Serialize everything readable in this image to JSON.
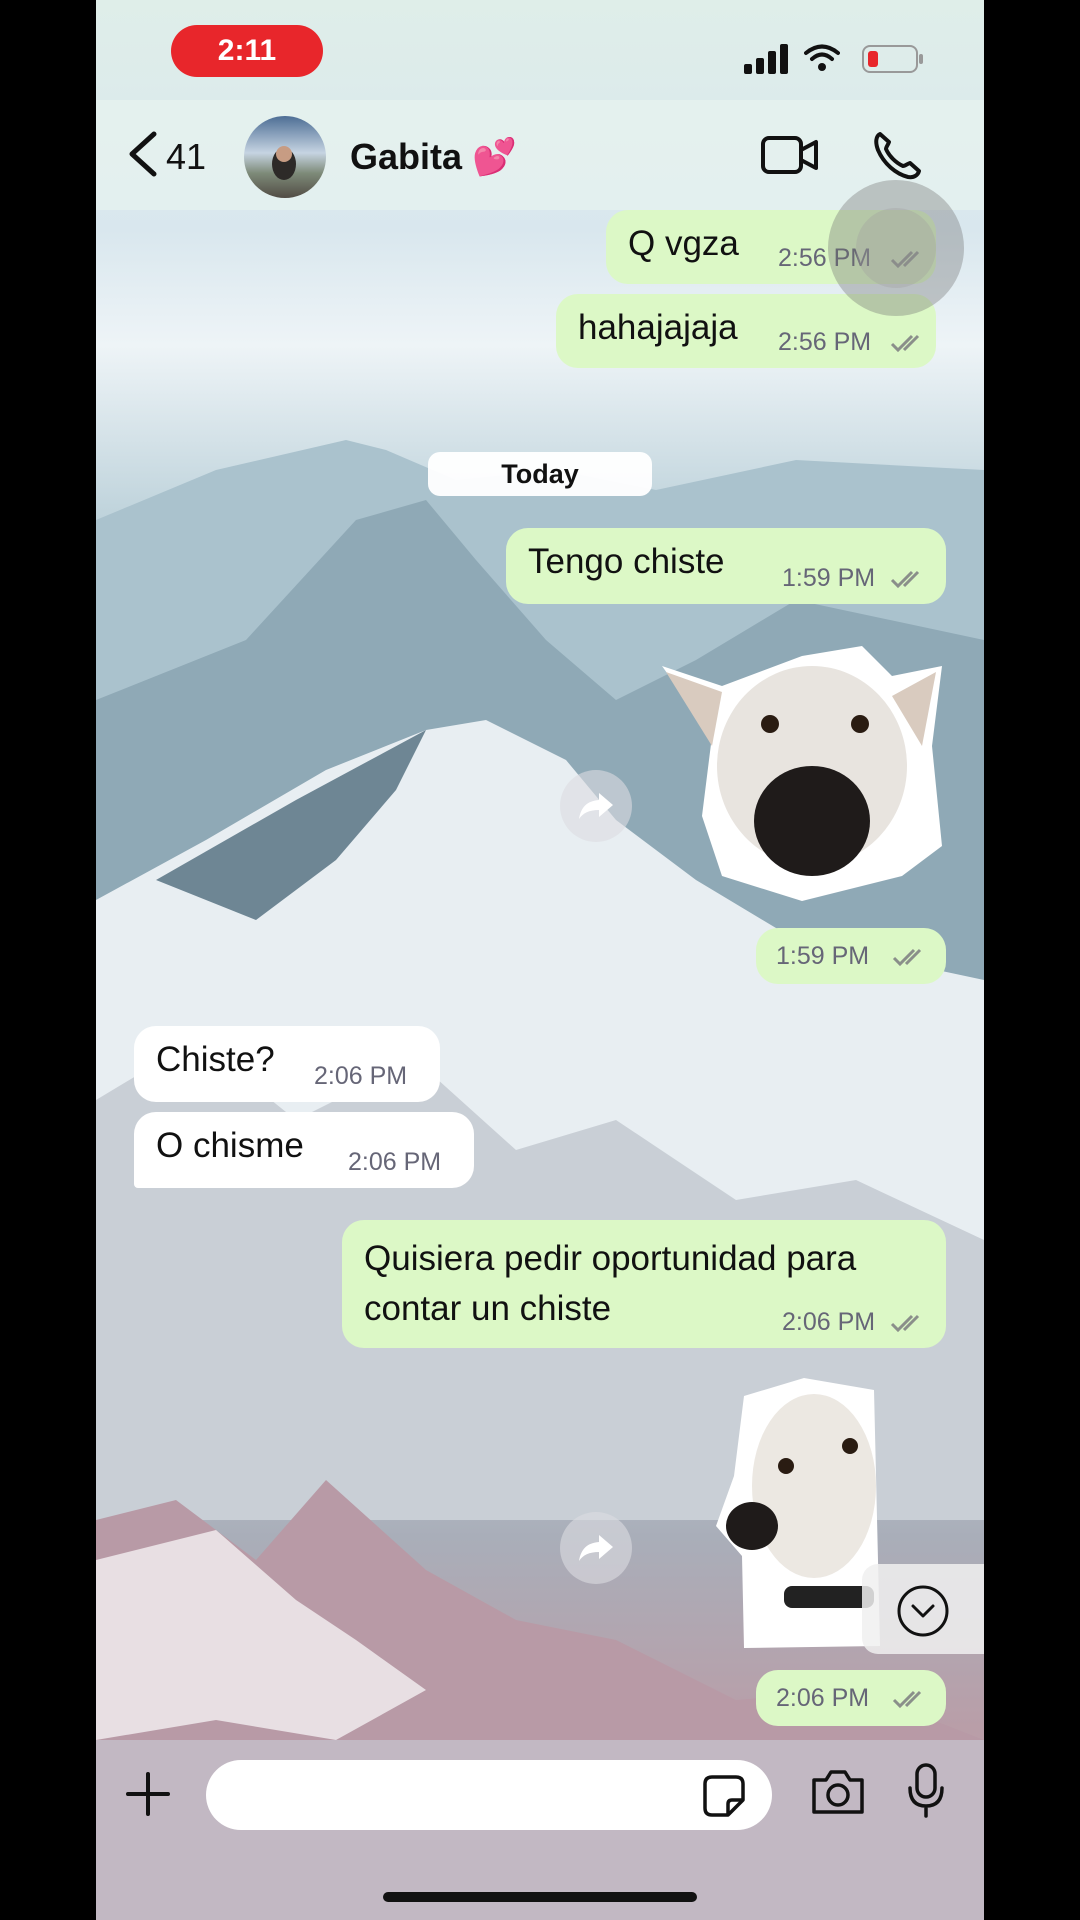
{
  "status_bar": {
    "time": "2:11"
  },
  "header": {
    "back_count": "41",
    "contact_name": "Gabita 💕"
  },
  "date_divider": "Today",
  "messages": [
    {
      "text": "Q vgza",
      "time": "2:56 PM"
    },
    {
      "text": "hahajajaja",
      "time": "2:56 PM"
    },
    {
      "text": "Tengo chiste",
      "time": "1:59 PM"
    },
    {
      "text": "",
      "time": "1:59 PM"
    },
    {
      "text": "Chiste?",
      "time": "2:06 PM"
    },
    {
      "text": "O chisme",
      "time": "2:06 PM"
    },
    {
      "text": "Quisiera pedir oportunidad para contar un chiste",
      "time": "2:06 PM"
    },
    {
      "text": "",
      "time": "2:06 PM"
    }
  ],
  "icons": {
    "back": "chevron-left-icon",
    "video": "video-camera-icon",
    "call": "phone-icon",
    "forward": "forward-arrow-icon",
    "scroll": "chevron-down-circle-icon",
    "add": "plus-icon",
    "sticker": "sticker-icon",
    "camera": "camera-icon",
    "mic": "microphone-icon"
  },
  "colors": {
    "outgoing_bubble": "#dcf8c6",
    "incoming_bubble": "#ffffff",
    "time_pill": "#e8262b"
  }
}
